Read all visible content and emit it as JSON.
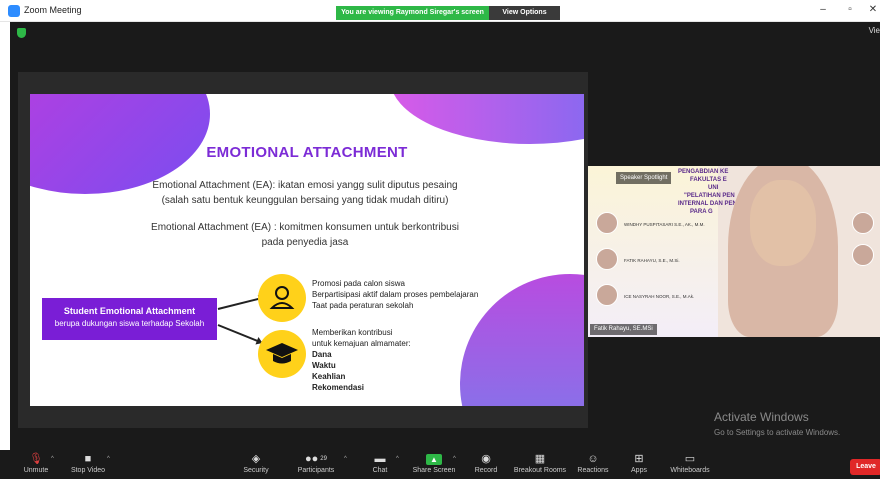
{
  "window": {
    "title": "Zoom Meeting",
    "viewing_banner": "You are viewing Raymond Siregar's screen",
    "view_options": "View Options",
    "view_right": "Vie"
  },
  "slide": {
    "title": "EMOTIONAL ATTACHMENT",
    "def1_line1": "Emotional Attachment (EA): ikatan emosi yangg sulit diputus pesaing",
    "def1_line2": "(salah satu bentuk keunggulan bersaing yang tidak mudah ditiru)",
    "def2_line1": "Emotional Attachment (EA) : komitmen konsumen untuk berkontribusi",
    "def2_line2": "pada penyedia jasa",
    "box_title": "Student Emotional Attachment",
    "box_sub": "berupa dukungan siswa terhadap Sekolah",
    "group1": [
      "Promosi pada calon siswa",
      "Berpartisipasi aktif dalam proses pembelajaran",
      "Taat pada peraturan sekolah"
    ],
    "group2_intro1": "Memberikan kontribusi",
    "group2_intro2": "untuk kemajuan almamater:",
    "group2_bold": [
      "Dana",
      "Waktu",
      "Keahlian",
      "Rekomendasi"
    ]
  },
  "video": {
    "speaker_tag": "Speaker Spotlight",
    "banner_line1": "PENGABDIAN KE",
    "banner_line2": "FAKULTAS E",
    "banner_line3": "UNI",
    "banner_line4": "\"PELATIHAN PEN",
    "banner_line5": "INTERNAL DAN PEN",
    "banner_line6": "PARA G",
    "name1": "WINDHY PUSPITASARI S.E., AK., M.M.",
    "name2": "FATIK RAHAYU, S.E., M.Si.",
    "name3": "ICE NASYRAH NOOR, S.E., M.Ak.",
    "participant_name": "Fatik Rahayu, SE.MSi"
  },
  "watermark": {
    "title": "Activate Windows",
    "sub": "Go to Settings to activate Windows."
  },
  "toolbar": {
    "unmute": "Unmute",
    "stop_video": "Stop Video",
    "security": "Security",
    "participants": "Participants",
    "participants_count": "29",
    "chat": "Chat",
    "share_screen": "Share Screen",
    "record": "Record",
    "breakout_rooms": "Breakout Rooms",
    "reactions": "Reactions",
    "apps": "Apps",
    "whiteboards": "Whiteboards",
    "leave": "Leave"
  },
  "colors": {
    "accent_green": "#2eb847",
    "slide_purple": "#7a1ed6",
    "bullet_yellow": "#ffd11a",
    "leave_red": "#e02828"
  }
}
